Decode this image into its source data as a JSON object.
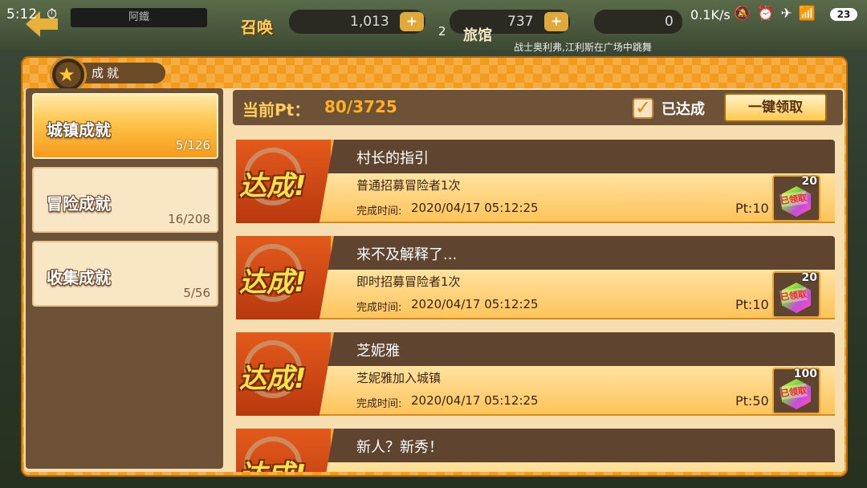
{
  "status_bar": {
    "time": "5:12",
    "net_speed": "0.1K/s",
    "battery": "23"
  },
  "game_bar": {
    "summon_label": "召唤",
    "currency1": "1,013",
    "currency2": "737",
    "currency3": "0",
    "tavern_label": "旅馆",
    "tavern_count": "2",
    "ticker": "战士奥利弗,江利斯在广场中跳舞",
    "player_name": "阿鐵"
  },
  "panel": {
    "title": "成就",
    "current_pt_label": "当前Pt：",
    "current_pt_value": "80/3725",
    "filter_label": "已达成",
    "claim_all": "一键领取"
  },
  "categories": [
    {
      "label": "城镇成就",
      "count": "5/126",
      "active": true
    },
    {
      "label": "冒险成就",
      "count": "16/208",
      "active": false
    },
    {
      "label": "收集成就",
      "count": "5/56",
      "active": false
    }
  ],
  "achievements": [
    {
      "badge": "达成!",
      "title": "村长的指引",
      "desc": "普通招募冒险者1次",
      "time_label": "完成时间:",
      "time": "2020/04/17 05:12:25",
      "pt": "Pt:10",
      "reward_qty": "20",
      "reward_stamp": "已领取"
    },
    {
      "badge": "达成!",
      "title": "来不及解释了...",
      "desc": "即时招募冒险者1次",
      "time_label": "完成时间:",
      "time": "2020/04/17 05:12:25",
      "pt": "Pt:10",
      "reward_qty": "20",
      "reward_stamp": "已领取"
    },
    {
      "badge": "达成!",
      "title": "芝妮雅",
      "desc": "芝妮雅加入城镇",
      "time_label": "完成时间:",
      "time": "2020/04/17 05:12:25",
      "pt": "Pt:50",
      "reward_qty": "100",
      "reward_stamp": "已领取"
    },
    {
      "badge": "达成!",
      "title": "新人？新秀！"
    }
  ],
  "colors": {
    "accent": "#f39b1c",
    "panel_bg": "#f6deb0",
    "dark_brown": "#6e5238"
  }
}
